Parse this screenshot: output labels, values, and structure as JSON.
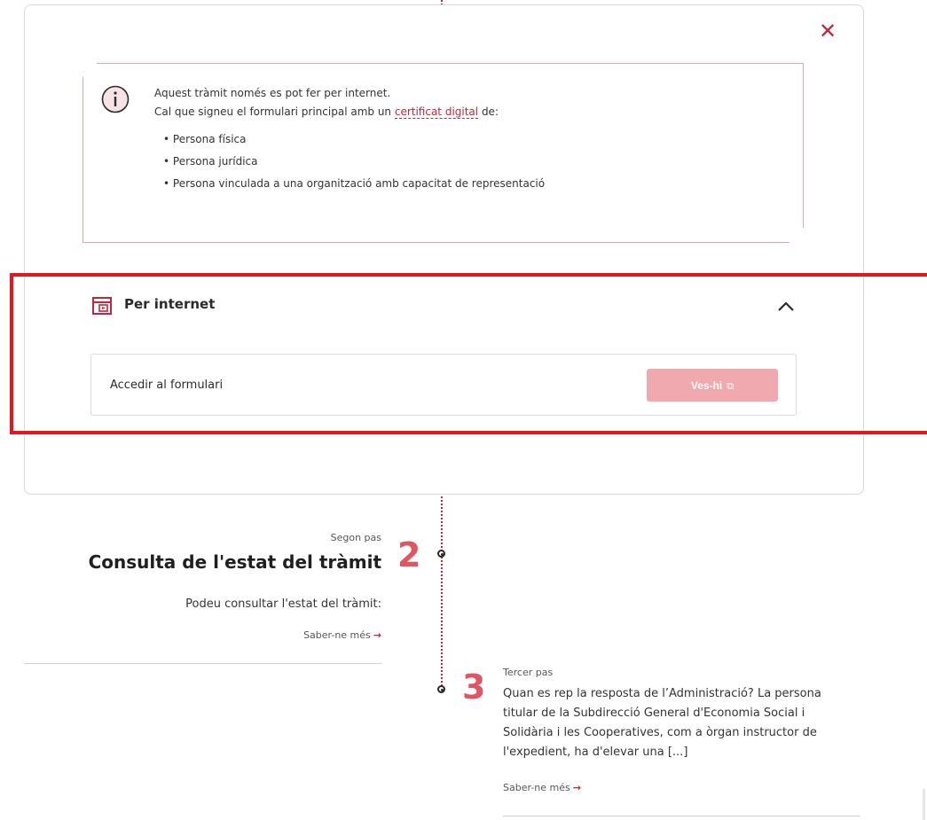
{
  "close": {
    "icon": "✕"
  },
  "info": {
    "line1": "Aquest tràmit només es pot fer per internet.",
    "line2_before": "Cal que signeu el formulari principal amb un ",
    "line2_link": "certificat digital",
    "line2_after": " de:",
    "items": [
      "Persona física",
      "Persona jurídica",
      "Persona vinculada a una organització amb capacitat de representació"
    ]
  },
  "online": {
    "title": "Per internet",
    "form_label": "Accedir al formulari",
    "button_label": "Ves-hi",
    "button_icon": "⧉"
  },
  "step2": {
    "caption": "Segon pas",
    "number": "2",
    "title": "Consulta de l'estat del tràmit",
    "description": "Podeu consultar l'estat del tràmit:",
    "more": "Saber-ne més",
    "arrow": "→"
  },
  "step3": {
    "caption": "Tercer pas",
    "number": "3",
    "description": "Quan es rep la resposta de l’Administració? La persona titular de la Subdirecció General d'Economia Social i Solidària i les Cooperatives, com a òrgan instructor de l'expedient, ha d'elevar una [...]",
    "more": "Saber-ne més",
    "arrow": "→"
  },
  "colors": {
    "accent": "#c0273a",
    "button_disabled": "#f0a9ae",
    "highlight": "#e8141f"
  }
}
